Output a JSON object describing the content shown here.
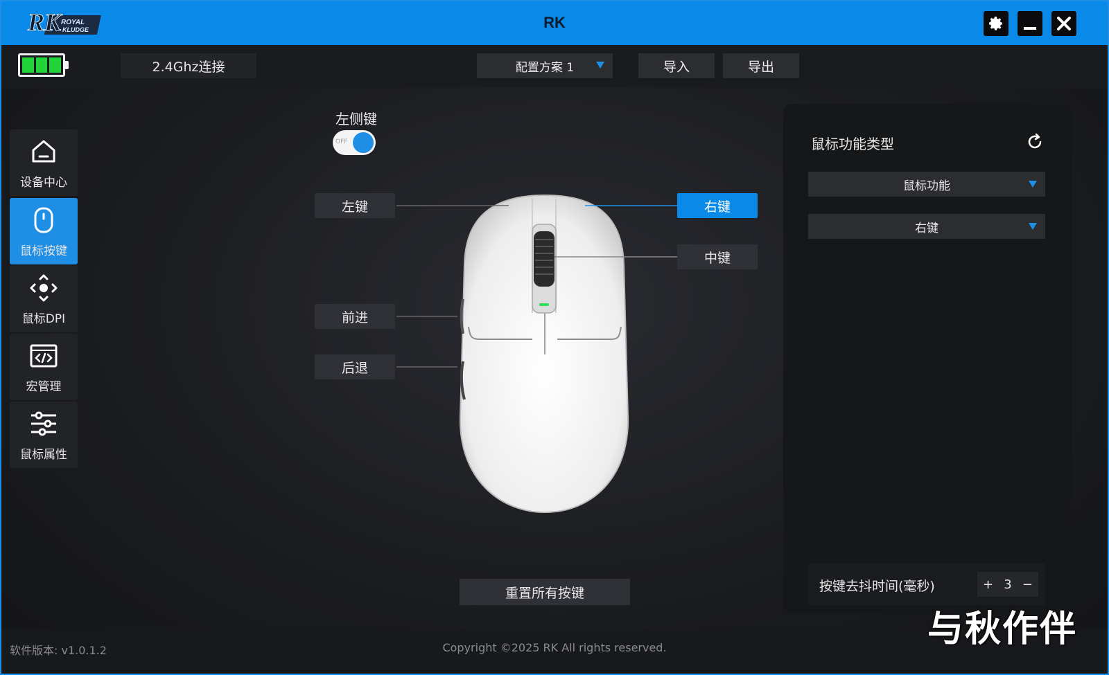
{
  "titlebar": {
    "title": "RK",
    "logo_text": "RK",
    "logo_sub1": "ROYAL",
    "logo_sub2": "KLUDGE"
  },
  "toolbar": {
    "connection": "2.4Ghz连接",
    "profile": "配置方案 1",
    "import_label": "导入",
    "export_label": "导出",
    "battery_cells": 3
  },
  "sidebar": {
    "items": [
      {
        "label": "设备中心",
        "icon": "home-icon",
        "active": false
      },
      {
        "label": "鼠标按键",
        "icon": "mouse-icon",
        "active": true
      },
      {
        "label": "鼠标DPI",
        "icon": "dpi-icon",
        "active": false
      },
      {
        "label": "宏管理",
        "icon": "macro-icon",
        "active": false
      },
      {
        "label": "鼠标属性",
        "icon": "sliders-icon",
        "active": false
      }
    ]
  },
  "center": {
    "side_key_label": "左侧键",
    "toggle_text": "OFF",
    "buttons": {
      "left": "左键",
      "right": "右键",
      "middle": "中键",
      "forward": "前进",
      "back": "后退"
    },
    "reset_label": "重置所有按键"
  },
  "panel": {
    "title": "鼠标功能类型",
    "function_type": "鼠标功能",
    "function_value": "右键",
    "debounce_label": "按键去抖时间(毫秒)",
    "debounce_value": "3",
    "plus": "+",
    "minus": "−"
  },
  "footer": {
    "version": "软件版本: v1.0.1.2",
    "copyright": "Copyright ©2025 RK All rights reserved."
  },
  "watermark": "与秋作伴",
  "colors": {
    "accent": "#0a8ae8",
    "battery": "#22d43a"
  }
}
